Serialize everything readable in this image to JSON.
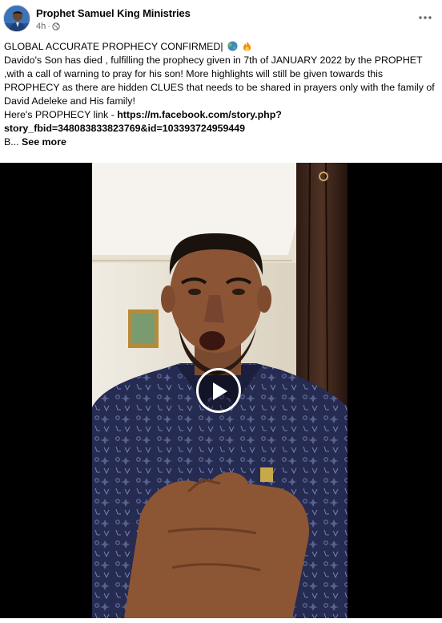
{
  "post": {
    "page_name": "Prophet Samuel King Ministries",
    "time": "4h",
    "separator": "·",
    "audience_icon": "globe-icon",
    "more_icon": "more-horizontal-icon"
  },
  "content": {
    "headline": "GLOBAL ACCURATE PROPHECY CONFIRMED|",
    "headline_emojis": [
      "globe-emoji",
      "fire-emoji"
    ],
    "paragraph": "Davido's Son has died , fulfilling the prophecy given in  7th of JANUARY 2022 by the PROPHET ,with a call of warning to pray for his son! More highlights will still be given towards this PROPHECY as there are hidden CLUES that needs to be shared in prayers only with the family of David Adeleke and His family!",
    "link_prefix": "Here's PROPHECY link - ",
    "link_url_line1": "https://m.facebook.com/story.php?",
    "link_url_line2": "story_fbid=348083833823769&id=103393724959449",
    "truncated_text": "B... ",
    "see_more": "See more"
  },
  "video": {
    "play_icon": "play-icon"
  },
  "colors": {
    "text": "#050505",
    "secondary": "#65676b",
    "video_bg": "#000000",
    "shirt": "#252a4e"
  }
}
